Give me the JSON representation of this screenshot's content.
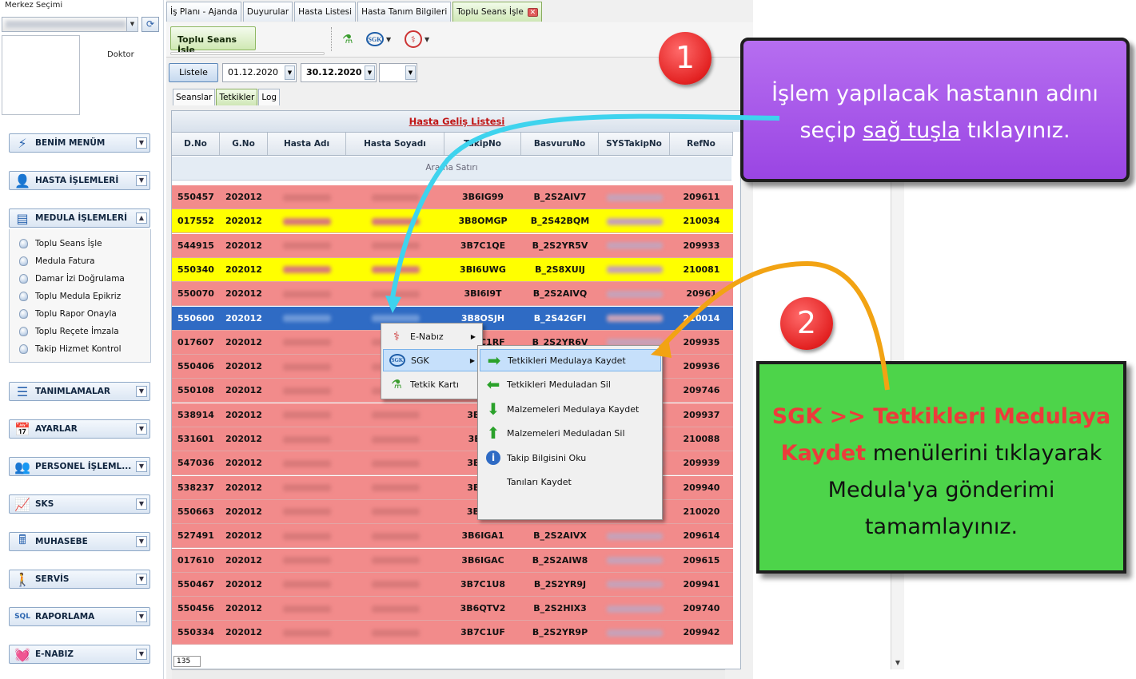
{
  "sidebar": {
    "merkez_label": "Merkez Seçimi",
    "doktor_label": "Doktor",
    "nav": [
      {
        "label": "BENİM MENÜM",
        "icon": "my-menu-icon",
        "glyph": "⚡"
      },
      {
        "label": "HASTA İŞLEMLERİ",
        "icon": "patient-icon",
        "glyph": "👤"
      },
      {
        "label": "MEDULA İŞLEMLERİ",
        "icon": "windows-icon",
        "glyph": "▤"
      },
      {
        "label": "TANIMLAMALAR",
        "icon": "list-icon",
        "glyph": "☰"
      },
      {
        "label": "AYARLAR",
        "icon": "calendar-clock-icon",
        "glyph": "📅"
      },
      {
        "label": "PERSONEL İŞLEML...",
        "icon": "staff-icon",
        "glyph": "👥"
      },
      {
        "label": "SKS",
        "icon": "chart-icon",
        "glyph": "📈"
      },
      {
        "label": "MUHASEBE",
        "icon": "register-icon",
        "glyph": "🖩"
      },
      {
        "label": "SERVİS",
        "icon": "service-icon",
        "glyph": "🚶"
      },
      {
        "label": "RAPORLAMA",
        "icon": "sql-icon",
        "glyph": "SQL"
      },
      {
        "label": "E-NABIZ",
        "icon": "pulse-icon",
        "glyph": "💓"
      }
    ],
    "medula_items": [
      "Toplu Seans İşle",
      "Medula Fatura",
      "Damar İzi Doğrulama",
      "Toplu Medula Epikriz",
      "Toplu Rapor Onayla",
      "Toplu Reçete İmzala",
      "Takip Hizmet Kontrol"
    ]
  },
  "tabs": [
    "İş Planı - Ajanda",
    "Duyurular",
    "Hasta Listesi",
    "Hasta Tanım Bilgileri",
    "Toplu Seans İşle"
  ],
  "toolbar": {
    "toplu_seans": "Toplu Seans İşle",
    "sgk_text": "SGK"
  },
  "filter": {
    "listele": "Listele",
    "date_from": "01.12.2020",
    "date_to": "30.12.2020"
  },
  "subtabs": [
    "Seanslar",
    "Tetkikler",
    "Log"
  ],
  "grid": {
    "title": "Hasta Geliş Listesi",
    "headers": [
      "D.No",
      "G.No",
      "Hasta Adı",
      "Hasta Soyadı",
      "TakipNo",
      "BasvuruNo",
      "SYSTakipNo",
      "RefNo"
    ],
    "search_row": "Arama Satırı",
    "rows": [
      {
        "d": "550457",
        "g": "202012",
        "takip": "3B6IG99",
        "basvuru": "B_2S2AIV7",
        "ref": "209611",
        "color": "#f28b8b"
      },
      {
        "d": "017552",
        "g": "202012",
        "takip": "3B8OMGP",
        "basvuru": "B_2S42BQM",
        "ref": "210034",
        "color": "#ffff00"
      },
      {
        "d": "544915",
        "g": "202012",
        "takip": "3B7C1QE",
        "basvuru": "B_2S2YR5V",
        "ref": "209933",
        "color": "#f28b8b"
      },
      {
        "d": "550340",
        "g": "202012",
        "takip": "3BI6UWG",
        "basvuru": "B_2S8XUIJ",
        "ref": "210081",
        "color": "#ffff00"
      },
      {
        "d": "550070",
        "g": "202012",
        "takip": "3BI6I9T",
        "basvuru": "B_2S2AIVQ",
        "ref": "20961",
        "color": "#f28b8b"
      },
      {
        "d": "550600",
        "g": "202012",
        "takip": "3B8OSJH",
        "basvuru": "B_2S42GFI",
        "ref": "210014",
        "color": "#2f6bc4",
        "selected": true
      },
      {
        "d": "017607",
        "g": "202012",
        "takip": "3B7C1RF",
        "basvuru": "B_2S2YR6V",
        "ref": "209935",
        "color": "#f28b8b"
      },
      {
        "d": "550406",
        "g": "202012",
        "takip": "",
        "basvuru": "",
        "ref": "209936",
        "color": "#f28b8b"
      },
      {
        "d": "550108",
        "g": "202012",
        "takip": "",
        "basvuru": "",
        "ref": "209746",
        "color": "#f28b8b"
      },
      {
        "d": "538914",
        "g": "202012",
        "takip": "3B7C1",
        "basvuru": "",
        "ref": "209937",
        "color": "#f28b8b"
      },
      {
        "d": "531601",
        "g": "202012",
        "takip": "3BKW",
        "basvuru": "",
        "ref": "210088",
        "color": "#f28b8b"
      },
      {
        "d": "547036",
        "g": "202012",
        "takip": "3B7C1",
        "basvuru": "",
        "ref": "209939",
        "color": "#f28b8b"
      },
      {
        "d": "538237",
        "g": "202012",
        "takip": "3B7C1",
        "basvuru": "",
        "ref": "209940",
        "color": "#f28b8b"
      },
      {
        "d": "550663",
        "g": "202012",
        "takip": "3B7VC",
        "basvuru": "",
        "ref": "210020",
        "color": "#f28b8b"
      },
      {
        "d": "527491",
        "g": "202012",
        "takip": "3B6IGA1",
        "basvuru": "B_2S2AIVX",
        "ref": "209614",
        "color": "#f28b8b"
      },
      {
        "d": "017610",
        "g": "202012",
        "takip": "3B6IGAC",
        "basvuru": "B_2S2AIW8",
        "ref": "209615",
        "color": "#f28b8b"
      },
      {
        "d": "550467",
        "g": "202012",
        "takip": "3B7C1U8",
        "basvuru": "B_2S2YR9J",
        "ref": "209941",
        "color": "#f28b8b"
      },
      {
        "d": "550456",
        "g": "202012",
        "takip": "3B6QTV2",
        "basvuru": "B_2S2HIX3",
        "ref": "209740",
        "color": "#f28b8b"
      },
      {
        "d": "550334",
        "g": "202012",
        "takip": "3B7C1UF",
        "basvuru": "B_2S2YR9P",
        "ref": "209942",
        "color": "#f28b8b"
      }
    ],
    "footer_count": "135"
  },
  "context_menu": {
    "items": [
      "E-Nabız",
      "SGK",
      "Tetkik Kartı"
    ],
    "submenu": [
      "Tetkikleri Medulaya Kaydet",
      "Tetkikleri Meduladan Sil",
      "Malzemeleri Medulaya Kaydet",
      "Malzemeleri Meduladan Sil",
      "Takip Bilgisini Oku",
      "Tanıları Kaydet"
    ]
  },
  "callouts": {
    "badge1": "1",
    "badge2": "2",
    "purple_line1": "İşlem yapılacak hastanın adını",
    "purple_line2_a": "seçip ",
    "purple_line2_u": "sağ tuşla",
    "purple_line2_b": " tıklayınız.",
    "green_red_1": "SGK >> Tetkikleri Medulaya",
    "green_red_2": "Kaydet",
    "green_rest_2": " menülerini tıklayarak",
    "green_line3": "Medula'ya gönderimi",
    "green_line4": "tamamlayınız."
  }
}
